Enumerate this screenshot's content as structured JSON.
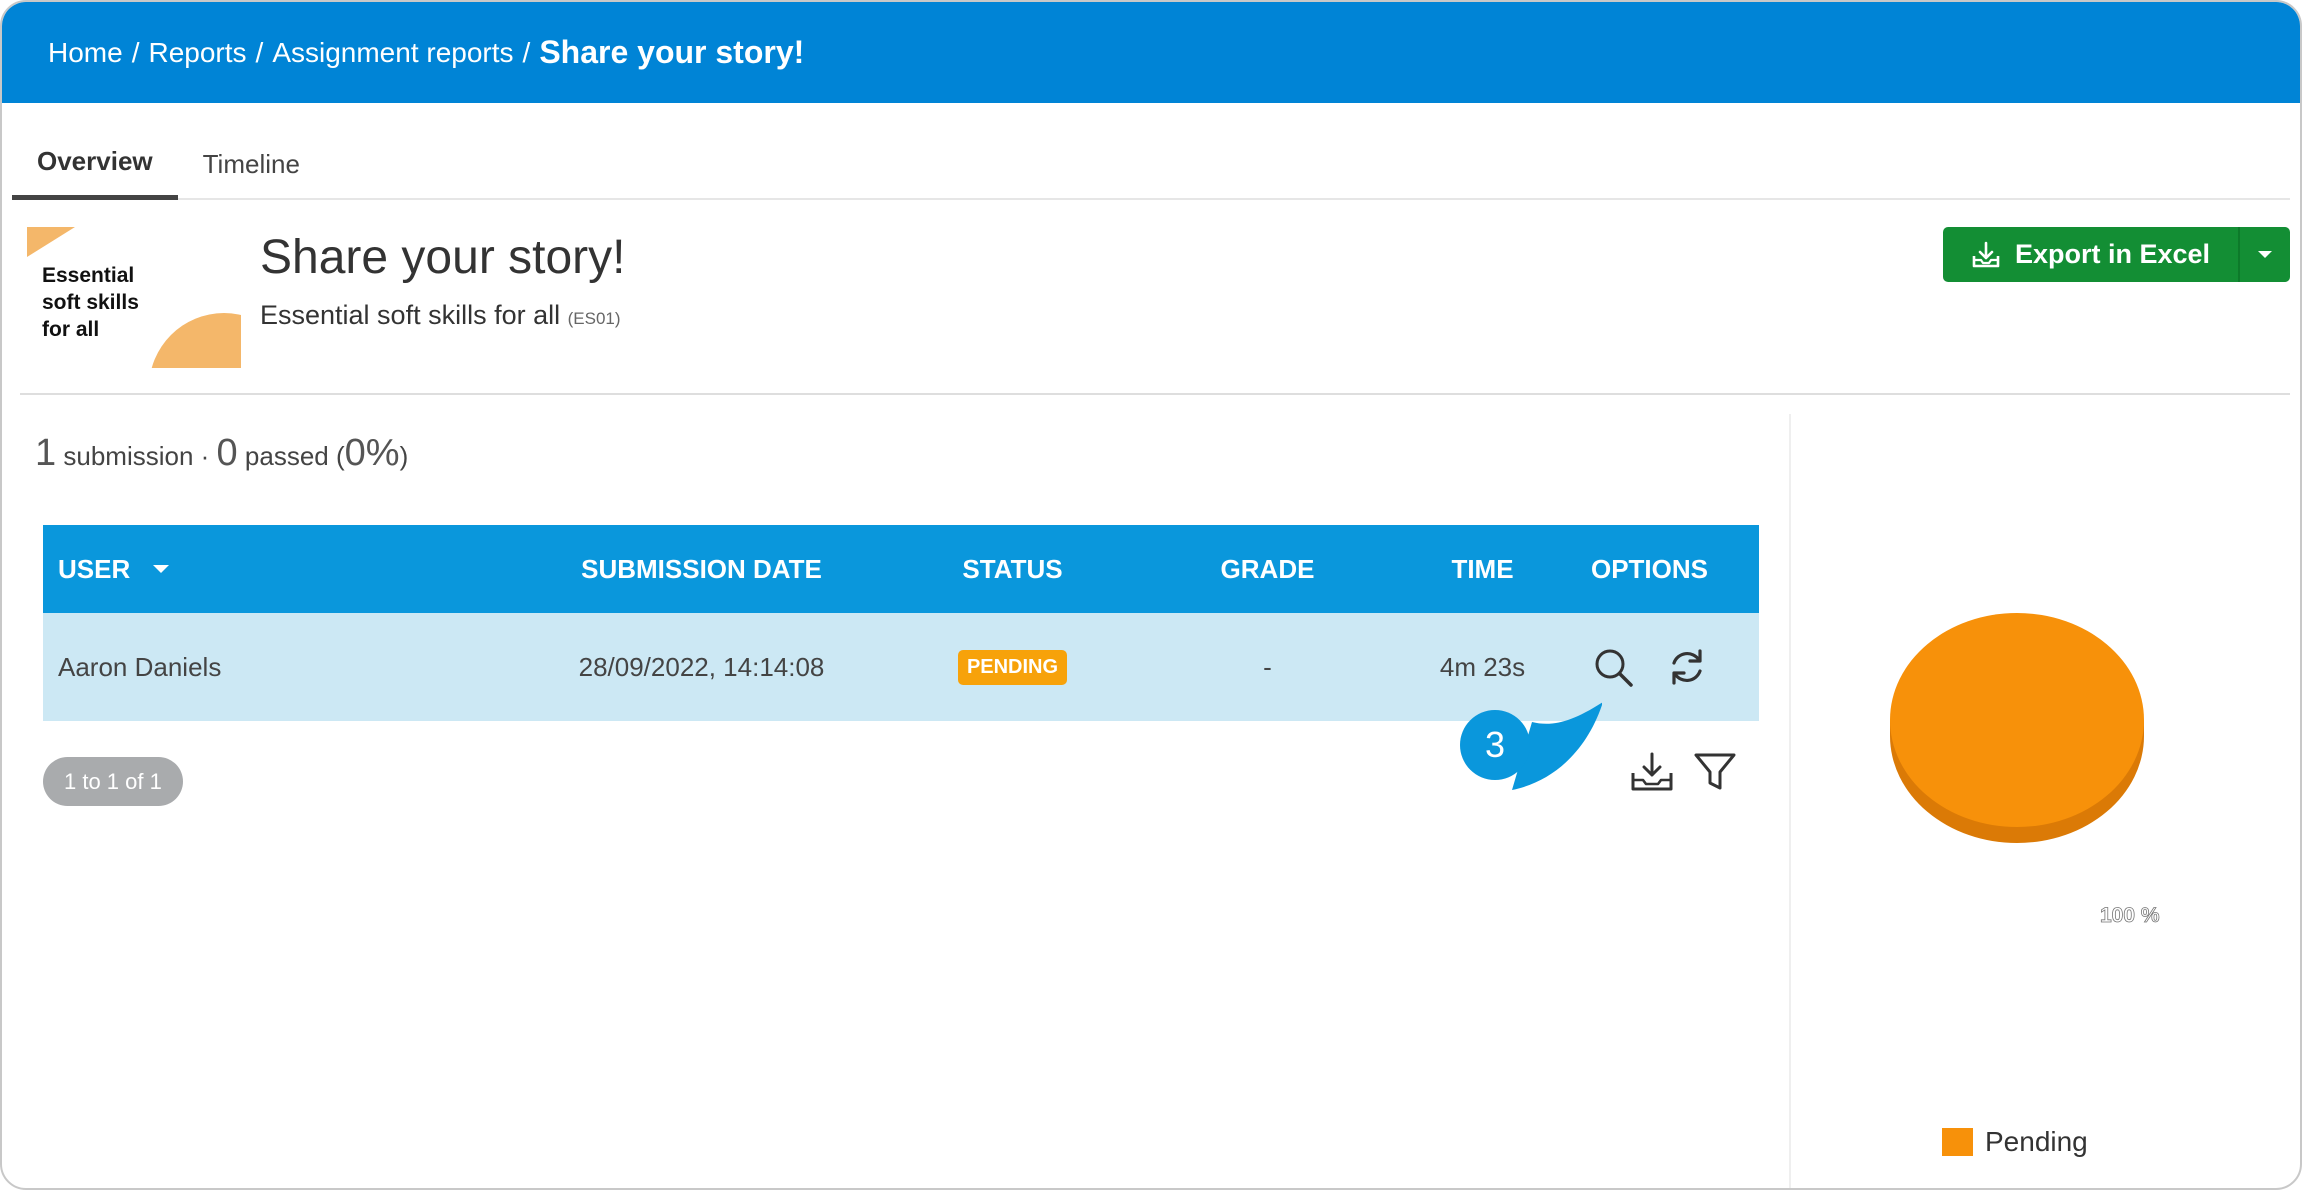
{
  "breadcrumb": {
    "items": [
      "Home",
      "Reports",
      "Assignment reports"
    ],
    "separator": "/",
    "current": "Share your story!"
  },
  "tabs": [
    {
      "label": "Overview",
      "active": true
    },
    {
      "label": "Timeline",
      "active": false
    }
  ],
  "course": {
    "thumbnail_text": "Essential soft skills for all",
    "title": "Share your story!",
    "subtitle": "Essential soft skills for all",
    "code": "(ES01)"
  },
  "export_button": {
    "label": "Export in Excel",
    "icon": "download-tray-icon",
    "color": "#138e34"
  },
  "summary": {
    "submissions": "1",
    "submissions_label": "submission ·",
    "passed": "0",
    "passed_label": "passed (",
    "percent": "0%",
    "close": ")"
  },
  "table": {
    "columns": [
      "USER",
      "SUBMISSION DATE",
      "STATUS",
      "GRADE",
      "TIME",
      "OPTIONS"
    ],
    "sort_column": "USER",
    "header_color": "#0a97dc",
    "rows": [
      {
        "user": "Aaron Daniels",
        "submission_date": "28/09/2022, 14:14:08",
        "status": "PENDING",
        "grade": "-",
        "time": "4m 23s",
        "options": [
          "search-icon",
          "refresh-icon"
        ]
      }
    ],
    "pager": "1 to 1 of 1",
    "tools": [
      "download-icon",
      "filter-icon"
    ]
  },
  "callout": {
    "number": "3",
    "color": "#0a97dc"
  },
  "chart_data": {
    "type": "pie",
    "categories": [
      "Pending"
    ],
    "values": [
      100
    ],
    "data_labels": [
      "100 %"
    ],
    "colors": [
      "#f7910a"
    ],
    "legend_placement": "bottom"
  }
}
